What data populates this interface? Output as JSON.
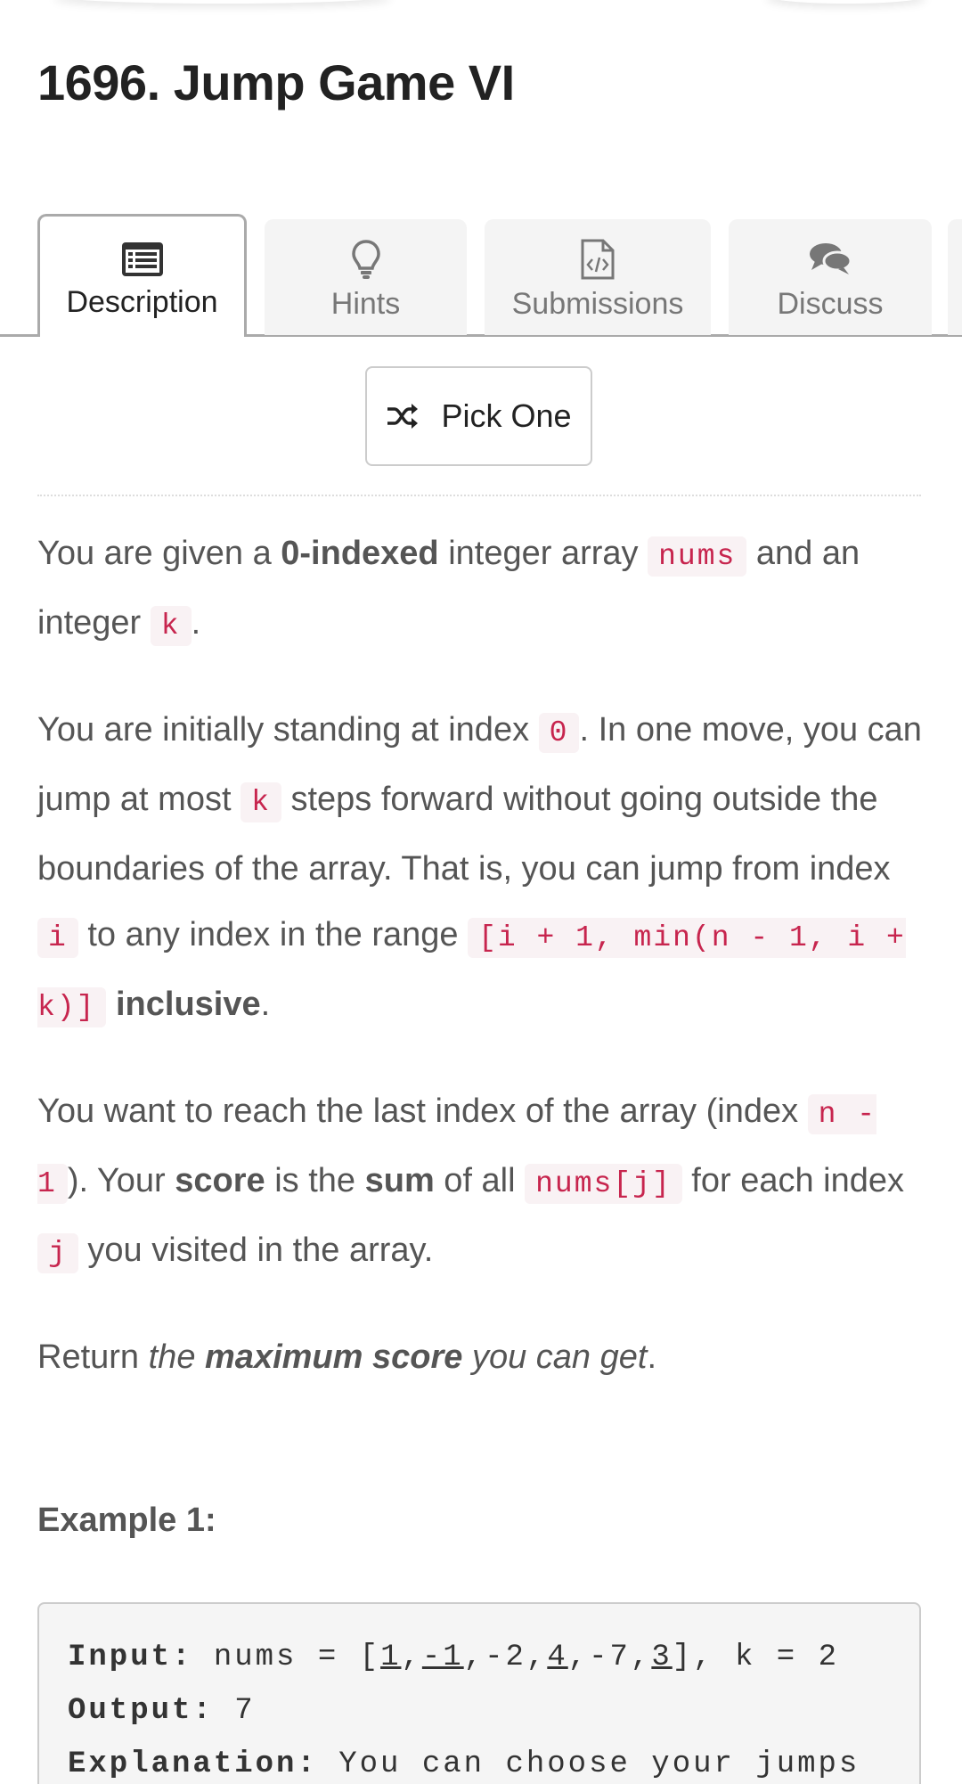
{
  "problem": {
    "title": "1696. Jump Game VI"
  },
  "tabs": [
    {
      "label": "Description",
      "icon": "list-icon",
      "active": true
    },
    {
      "label": "Hints",
      "icon": "lightbulb-icon",
      "active": false
    },
    {
      "label": "Submissions",
      "icon": "code-file-icon",
      "active": false
    },
    {
      "label": "Discuss",
      "icon": "comments-icon",
      "active": false
    }
  ],
  "pick_one": {
    "label": "Pick One",
    "icon": "shuffle-icon"
  },
  "description": {
    "p1": {
      "t1": "You are given a ",
      "b1": "0-indexed",
      "t2": " integer array ",
      "c1": "nums",
      "t3": " and an integer ",
      "c2": "k",
      "t4": "."
    },
    "p2": {
      "t1": "You are initially standing at index ",
      "c1": "0",
      "t2": ". In one move, you can jump at most ",
      "c2": "k",
      "t3": " steps forward without going outside the boundaries of the array. That is, you can jump from index ",
      "c3": "i",
      "t4": " to any index in the range ",
      "c4": "[i + 1, min(n - 1, i + k)]",
      "t5": " ",
      "b1": "inclusive",
      "t6": "."
    },
    "p3": {
      "t1": "You want to reach the last index of the array (index ",
      "c1": "n - 1",
      "t2": "). Your ",
      "b1": "score",
      "t3": " is the ",
      "b2": "sum",
      "t4": " of all ",
      "c2": "nums[j]",
      "t5": " for each index ",
      "c3": "j",
      "t6": " you visited in the array."
    },
    "p4": {
      "t1": "Return ",
      "i1": "the ",
      "bi1": "maximum score",
      "i2": " you can get",
      "t2": "."
    }
  },
  "example1": {
    "title": "Example 1:",
    "input_label": "Input:",
    "input_pre": " nums = [",
    "v1": "1",
    "s1": ",",
    "v2": "-1",
    "s2": ",-2,",
    "v3": "4",
    "s3": ",-7,",
    "v4": "3",
    "input_post": "], k = 2",
    "output_label": "Output:",
    "output_value": " 7",
    "explanation_label": "Explanation:",
    "explanation_text": " You can choose your jumps"
  }
}
